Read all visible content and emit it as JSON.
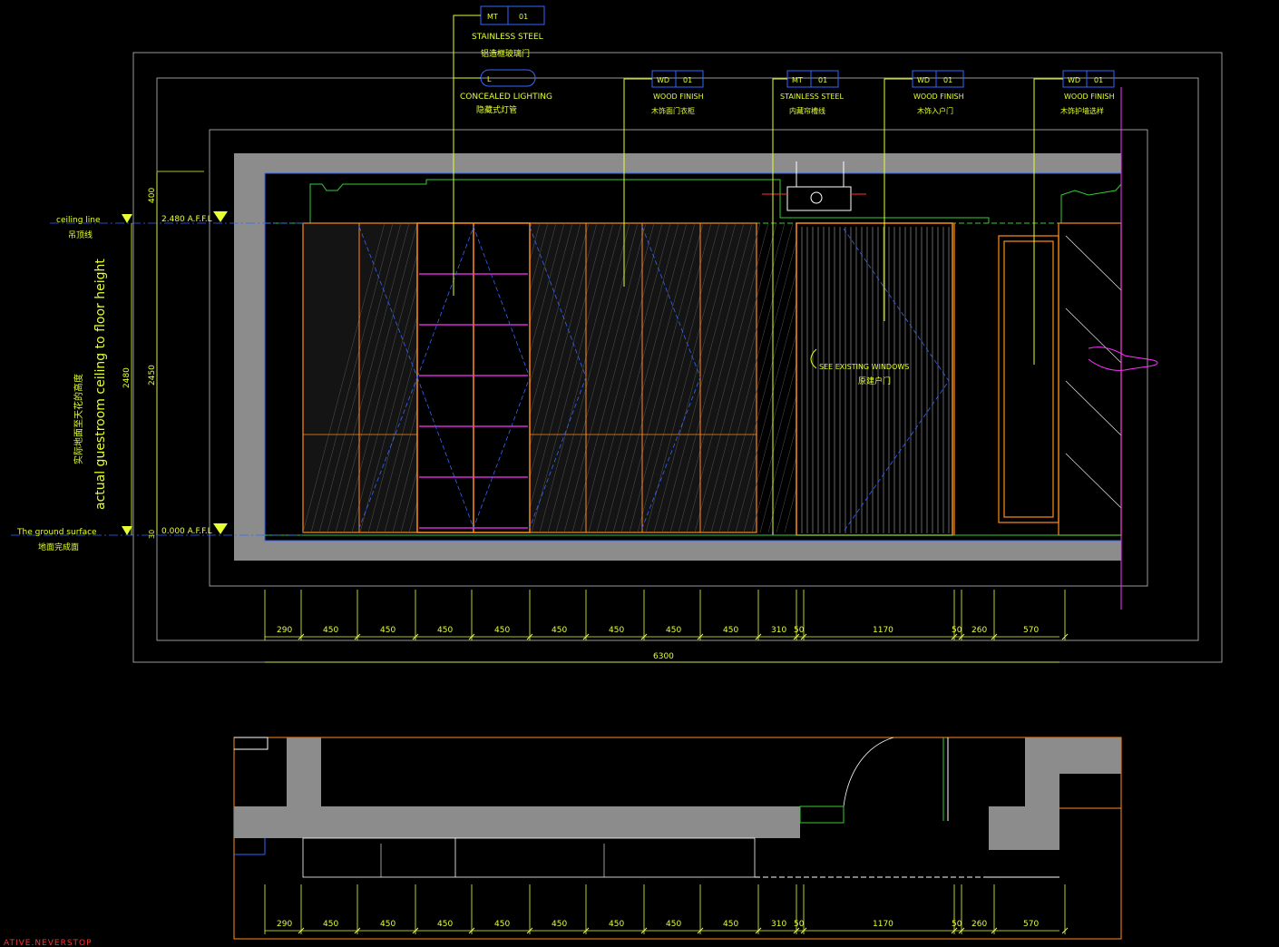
{
  "colors": {
    "background": "#000000",
    "wall_fill": "#8c8c8c",
    "frame": "#ffffff",
    "panel_orange": "#ff8c1a",
    "accent_green": "#33cc33",
    "leader_yellow": "#e6ff33",
    "blue_line": "#3366ff",
    "magenta": "#ff33ff",
    "dim_text": "#e6e633",
    "label_white": "#ffffff",
    "red": "#ff3333",
    "cyan_dash": "#33aacc"
  },
  "tags": [
    {
      "code": "MT",
      "num": "01",
      "label": "STAINLESS STEEL",
      "cn": "铝造框玻璃门"
    },
    {
      "code": "L",
      "num": "",
      "label": "CONCEALED LIGHTING",
      "cn": "隐藏式灯管"
    },
    {
      "code": "WD",
      "num": "01",
      "label": "WOOD FINISH",
      "cn": "木饰面门衣柜"
    },
    {
      "code": "MT",
      "num": "01",
      "label": "STAINLESS STEEL",
      "cn": "内藏帘槽线"
    },
    {
      "code": "WD",
      "num": "01",
      "label": "WOOD FINISH",
      "cn": "木饰入户门"
    },
    {
      "code": "WD",
      "num": "01",
      "label": "WOOD FINISH",
      "cn": "木饰护墙选样"
    }
  ],
  "levels": {
    "ceiling_label": "ceiling line",
    "ceiling_cn": "吊顶线",
    "ceiling_value": "2.480 A.F.F.L",
    "ground_label": "The ground surface",
    "ground_cn": "地面完成面",
    "ground_value": "0.000 A.F.F.L"
  },
  "vertical_dims": {
    "top": "400",
    "total": "2480",
    "inner": "2450",
    "bottom": "30"
  },
  "side_note": {
    "en": "actual guestroom ceiling to floor height",
    "cn": "实际地面至天花的高度"
  },
  "window_note": {
    "en": "SEE EXISTING WINDOWS",
    "cn": "原建户门"
  },
  "dimensions": [
    "290",
    "450",
    "450",
    "450",
    "450",
    "450",
    "450",
    "450",
    "450",
    "310",
    "50",
    "1170",
    "50",
    "260",
    "570"
  ],
  "total_dimension": "6300",
  "watermark": "ATIVE.NEVERSTOP"
}
